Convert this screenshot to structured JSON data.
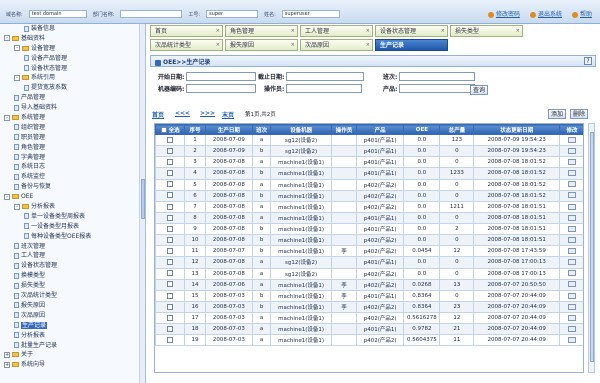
{
  "header": {
    "fields": [
      {
        "label": "域名称:",
        "value": "test domain"
      },
      {
        "label": "部门名称:",
        "value": ""
      },
      {
        "label": "工号:",
        "value": "super"
      },
      {
        "label": "姓名:",
        "value": "superuser"
      }
    ],
    "links": [
      "修改密码",
      "退出系统",
      "帮助"
    ]
  },
  "sidebar": {
    "items": [
      {
        "text": "装备信息",
        "indent": 2,
        "kind": "doc"
      },
      {
        "text": "基础资料",
        "indent": 0,
        "kind": "folder",
        "exp": "-"
      },
      {
        "text": "设备管理",
        "indent": 1,
        "kind": "folder",
        "exp": "-"
      },
      {
        "text": "设备产品管理",
        "indent": 2,
        "kind": "doc"
      },
      {
        "text": "设备状态管理",
        "indent": 2,
        "kind": "doc"
      },
      {
        "text": "系统引用",
        "indent": 1,
        "kind": "folder",
        "exp": "-"
      },
      {
        "text": "提货宽放系数",
        "indent": 2,
        "kind": "doc"
      },
      {
        "text": "产品管理",
        "indent": 1,
        "kind": "doc"
      },
      {
        "text": "导入基础资料",
        "indent": 1,
        "kind": "doc"
      },
      {
        "text": "系统管理",
        "indent": 0,
        "kind": "folder",
        "exp": "-"
      },
      {
        "text": "组织管理",
        "indent": 1,
        "kind": "doc"
      },
      {
        "text": "职员管理",
        "indent": 1,
        "kind": "doc"
      },
      {
        "text": "角色管理",
        "indent": 1,
        "kind": "doc"
      },
      {
        "text": "字典管理",
        "indent": 1,
        "kind": "doc"
      },
      {
        "text": "系统日志",
        "indent": 1,
        "kind": "doc"
      },
      {
        "text": "系统监控",
        "indent": 1,
        "kind": "doc"
      },
      {
        "text": "备份与恢复",
        "indent": 1,
        "kind": "doc"
      },
      {
        "text": "OEE",
        "indent": 0,
        "kind": "folder",
        "exp": "-"
      },
      {
        "text": "分析报表",
        "indent": 1,
        "kind": "folder",
        "exp": "-"
      },
      {
        "text": "单一设备类型周报表",
        "indent": 2,
        "kind": "doc"
      },
      {
        "text": "一设备类型月报表",
        "indent": 2,
        "kind": "doc"
      },
      {
        "text": "每种设备类型OEE报表",
        "indent": 2,
        "kind": "doc"
      },
      {
        "text": "班次管理",
        "indent": 1,
        "kind": "doc"
      },
      {
        "text": "工人管理",
        "indent": 1,
        "kind": "doc"
      },
      {
        "text": "设备状态管理",
        "indent": 1,
        "kind": "doc"
      },
      {
        "text": "换模类型",
        "indent": 1,
        "kind": "doc"
      },
      {
        "text": "损失类型",
        "indent": 1,
        "kind": "doc"
      },
      {
        "text": "次品统计类型",
        "indent": 1,
        "kind": "doc"
      },
      {
        "text": "报失原因",
        "indent": 1,
        "kind": "doc"
      },
      {
        "text": "次品原因",
        "indent": 1,
        "kind": "doc"
      },
      {
        "text": "生产记录",
        "indent": 1,
        "kind": "doc",
        "selected": true
      },
      {
        "text": "分析报表",
        "indent": 1,
        "kind": "doc"
      },
      {
        "text": "批量生产记录",
        "indent": 1,
        "kind": "doc"
      },
      {
        "text": "关于",
        "indent": 0,
        "kind": "folder",
        "exp": "+"
      },
      {
        "text": "系统向导",
        "indent": 0,
        "kind": "folder",
        "exp": "+"
      }
    ]
  },
  "tabs": {
    "row1": [
      "首页",
      "角色管理",
      "工人管理",
      "设备状态管理",
      "损失类型"
    ],
    "row2": [
      "次品统计类型",
      "报失原因",
      "次品原因",
      "生产记录"
    ],
    "active": "生产记录"
  },
  "page": {
    "breadcrumb": "OEE>>生产记录",
    "help": "?"
  },
  "filter": {
    "start_date_label": "开始日期:",
    "end_date_label": "截止日期:",
    "shift_label": "班次:",
    "machine_label": "机器编码:",
    "operator_label": "操作员:",
    "product_label": "产品:",
    "query_button": "查询"
  },
  "pager": {
    "first": "首页",
    "prev": "<<<",
    "next": ">>>",
    "last": "末页",
    "info": "第1页,共2页",
    "add_button": "添加",
    "delete_button": "删除"
  },
  "table": {
    "headers": [
      "全选",
      "序号",
      "生产日期",
      "班次",
      "设备机器",
      "操作员",
      "产品",
      "OEE",
      "总产量",
      "状态更新日期",
      "修改"
    ],
    "rows": [
      [
        "1",
        "2008-07-09",
        "a",
        "sg12(设备2)",
        "",
        "p401(产品1)",
        "0.0",
        "123",
        "2008-07-09 19:54:23"
      ],
      [
        "2",
        "2008-07-09",
        "b",
        "sg12(设备2)",
        "",
        "p401(产品1)",
        "0.0",
        "0",
        "2008-07-09 19:54:23"
      ],
      [
        "3",
        "2008-07-08",
        "a",
        "machine1(设备1)",
        "",
        "p401(产品1)",
        "0.0",
        "0",
        "2008-07-08 18:01:52"
      ],
      [
        "4",
        "2008-07-08",
        "b",
        "machine1(设备1)",
        "",
        "p401(产品1)",
        "0.0",
        "1233",
        "2008-07-08 18:01:52"
      ],
      [
        "5",
        "2008-07-08",
        "a",
        "machine1(设备1)",
        "",
        "p402(产品2)",
        "0.0",
        "0",
        "2008-07-08 18:01:52"
      ],
      [
        "6",
        "2008-07-08",
        "b",
        "machine1(设备1)",
        "",
        "p402(产品2)",
        "0.0",
        "0",
        "2008-07-08 18:01:52"
      ],
      [
        "7",
        "2008-07-08",
        "a",
        "machine1(设备1)",
        "",
        "p402(产品2)",
        "0.0",
        "1211",
        "2008-07-08 18:01:51"
      ],
      [
        "8",
        "2008-07-08",
        "a",
        "machine1(设备1)",
        "",
        "p401(产品1)",
        "0.0",
        "0",
        "2008-07-08 18:01:51"
      ],
      [
        "9",
        "2008-07-08",
        "b",
        "machine1(设备1)",
        "",
        "p401(产品1)",
        "0.0",
        "2",
        "2008-07-08 18:01:51"
      ],
      [
        "10",
        "2008-07-08",
        "b",
        "machine1(设备1)",
        "",
        "p402(产品2)",
        "0.0",
        "0",
        "2008-07-08 18:01:51"
      ],
      [
        "11",
        "2008-07-07",
        "b",
        "machine1(设备1)",
        "李",
        "p402(产品2)",
        "0.0454",
        "12",
        "2008-07-08 17:43:59"
      ],
      [
        "12",
        "2008-07-08",
        "a",
        "sg12(设备2)",
        "",
        "p401(产品1)",
        "0.0",
        "0",
        "2008-07-08 17:00:13"
      ],
      [
        "13",
        "2008-07-08",
        "a",
        "sg12(设备2)",
        "",
        "p402(产品2)",
        "0.0",
        "0",
        "2008-07-08 17:00:13"
      ],
      [
        "14",
        "2008-07-06",
        "a",
        "machine1(设备1)",
        "李",
        "p402(产品2)",
        "0.0268",
        "13",
        "2008-07-07 20:50:50"
      ],
      [
        "15",
        "2008-07-03",
        "b",
        "machine1(设备1)",
        "李",
        "p401(产品1)",
        "0.8364",
        "0",
        "2008-07-07 20:44:09"
      ],
      [
        "16",
        "2008-07-03",
        "b",
        "machine1(设备1)",
        "李",
        "p402(产品2)",
        "0.8364",
        "23",
        "2008-07-07 20:44:09"
      ],
      [
        "17",
        "2008-07-03",
        "a",
        "machine1(设备1)",
        "",
        "p402(产品2)",
        "0.5616278",
        "12",
        "2008-07-07 20:44:09"
      ],
      [
        "18",
        "2008-07-03",
        "a",
        "machine1(设备1)",
        "",
        "p401(产品1)",
        "0.9782",
        "21",
        "2008-07-07 20:44:09"
      ],
      [
        "19",
        "2008-07-03",
        "a",
        "machine1(设备1)",
        "",
        "p402(产品2)",
        "0.5604375",
        "11",
        "2008-07-07 20:44:09"
      ]
    ]
  }
}
